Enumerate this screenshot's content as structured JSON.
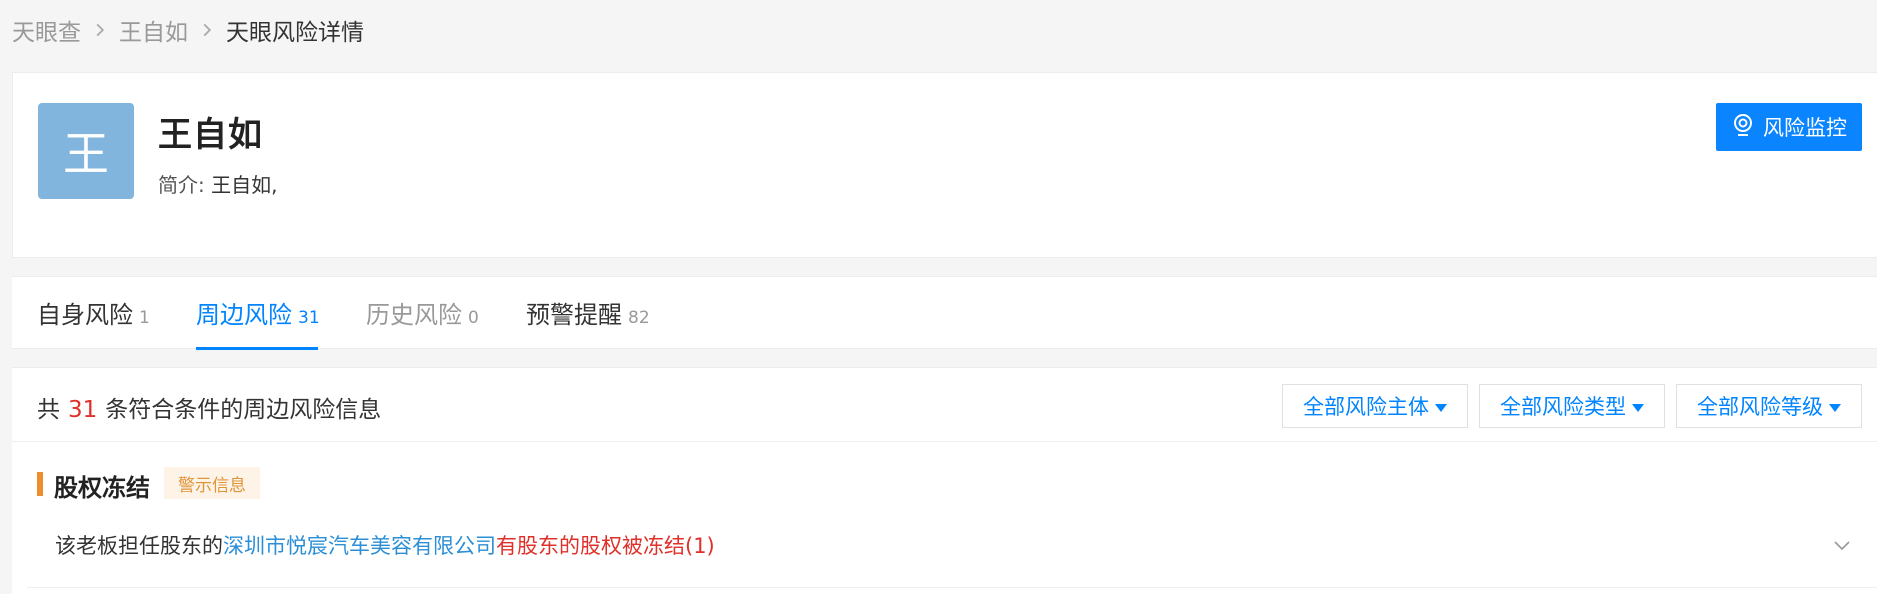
{
  "breadcrumb": {
    "items": [
      "天眼查",
      "王自如",
      "天眼风险详情"
    ]
  },
  "profile": {
    "avatar_char": "王",
    "name": "王自如",
    "intro_label": "简介:",
    "intro_text": "王自如,",
    "monitor_button": "风险监控"
  },
  "tabs": [
    {
      "label": "自身风险",
      "count": "1"
    },
    {
      "label": "周边风险",
      "count": "31"
    },
    {
      "label": "历史风险",
      "count": "0"
    },
    {
      "label": "预警提醒",
      "count": "82"
    }
  ],
  "summary": {
    "prefix": "共",
    "count": "31",
    "suffix": "条符合条件的周边风险信息"
  },
  "filters": [
    "全部风险主体",
    "全部风险类型",
    "全部风险等级"
  ],
  "section": {
    "title": "股权冻结",
    "tag": "警示信息"
  },
  "risk_item": {
    "prefix": "该老板担任股东的",
    "company": "深圳市悦宸汽车美容有限公司",
    "highlight": "有股东的股权被冻结",
    "count": "(1)"
  },
  "colors": {
    "accent": "#0084ff",
    "alert": "#e0302a",
    "section_bar": "#f08d2c",
    "avatar_bg": "#82b5dd"
  }
}
